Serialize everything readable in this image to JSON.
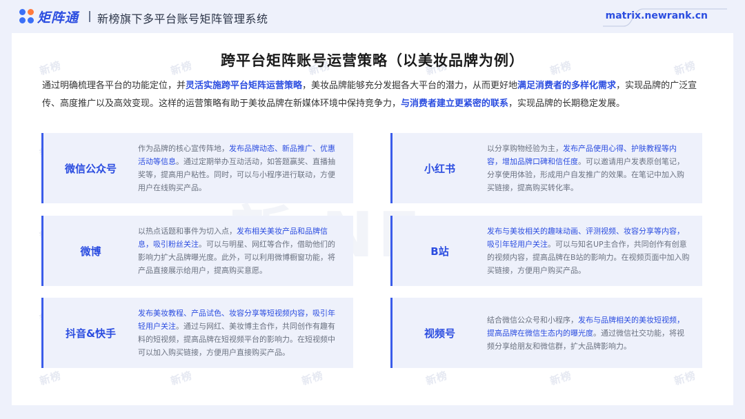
{
  "header": {
    "brand": "矩阵通",
    "title": "新榜旗下多平台账号矩阵管理系统",
    "url": "matrix.newrank.cn"
  },
  "watermark": {
    "text": "新榜",
    "big_text": "新 NE"
  },
  "main": {
    "title": "跨平台矩阵账号运营策略（以美妆品牌为例）",
    "intro": [
      {
        "t": "通过明确梳理各平台的功能定位，并",
        "hl": false
      },
      {
        "t": "灵活实施跨平台矩阵运营策略",
        "hl": true
      },
      {
        "t": "，美妆品牌能够充分发掘各大平台的潜力，从而更好地",
        "hl": false
      },
      {
        "t": "满足消费者的多样化需求",
        "hl": true
      },
      {
        "t": "，实现品牌的广泛宣传、高度推广以及高效变现。这样的运营策略有助于美妆品牌在新媒体环境中保持竞争力，",
        "hl": false
      },
      {
        "t": "与消费者建立更紧密的联系",
        "hl": true
      },
      {
        "t": "，实现品牌的长期稳定发展。",
        "hl": false
      }
    ],
    "cards": [
      {
        "name": "微信公众号",
        "desc": [
          {
            "t": "作为品牌的核心宣传阵地，",
            "hl": false
          },
          {
            "t": "发布品牌动态、新品推广、优惠活动等信息",
            "hl": true
          },
          {
            "t": "。通过定期举办互动活动，如答题赢奖、直播抽奖等，提高用户粘性。同时，可以与小程序进行联动，方便用户在线购买产品。",
            "hl": false
          }
        ]
      },
      {
        "name": "小红书",
        "desc": [
          {
            "t": "以分享购物经验为主，",
            "hl": false
          },
          {
            "t": "发布产品使用心得、护肤教程等内容，增加品牌口碑和信任度",
            "hl": true
          },
          {
            "t": "。可以邀请用户发表原创笔记，分享使用体验，形成用户自发推广的效果。在笔记中加入购买链接，提高购买转化率。",
            "hl": false
          }
        ]
      },
      {
        "name": "微博",
        "desc": [
          {
            "t": "以热点话题和事件为切入点，",
            "hl": false
          },
          {
            "t": "发布相关美妆产品和品牌信息，吸引粉丝关注",
            "hl": true
          },
          {
            "t": "。可以与明星、网红等合作，借助他们的影响力扩大品牌曝光度。此外，可以利用微博橱窗功能，将产品直接展示给用户，提高购买意愿。",
            "hl": false
          }
        ]
      },
      {
        "name": "B站",
        "desc": [
          {
            "t": "发布与美妆相关的趣味动画、评测视频、妆容分享等内容，吸引年轻用户关注",
            "hl": true
          },
          {
            "t": "。可以与知名UP主合作，共同创作有创意的视频内容，提高品牌在B站的影响力。在视频页面中加入购买链接，方便用户购买产品。",
            "hl": false
          }
        ]
      },
      {
        "name": "抖音&快手",
        "desc": [
          {
            "t": "发布美妆教程、产品试色、妆容分享等短视频内容，吸引年轻用户关注",
            "hl": true
          },
          {
            "t": "。通过与网红、美妆博主合作，共同创作有趣有料的短视频，提高品牌在短视频平台的影响力。在短视频中可以加入购买链接，方便用户直接购买产品。",
            "hl": false
          }
        ]
      },
      {
        "name": "视频号",
        "desc": [
          {
            "t": "结合微信公众号和小程序，",
            "hl": false
          },
          {
            "t": "发布与品牌相关的美妆短视频，提高品牌在微信生态内的曝光度",
            "hl": true
          },
          {
            "t": "。通过微信社交功能，将视频分享给朋友和微信群，扩大品牌影响力。",
            "hl": false
          }
        ]
      }
    ]
  },
  "colors": {
    "accent": "#2b4de0",
    "card_bg": "#eef1fb",
    "page_bg": "#eef1fb"
  }
}
